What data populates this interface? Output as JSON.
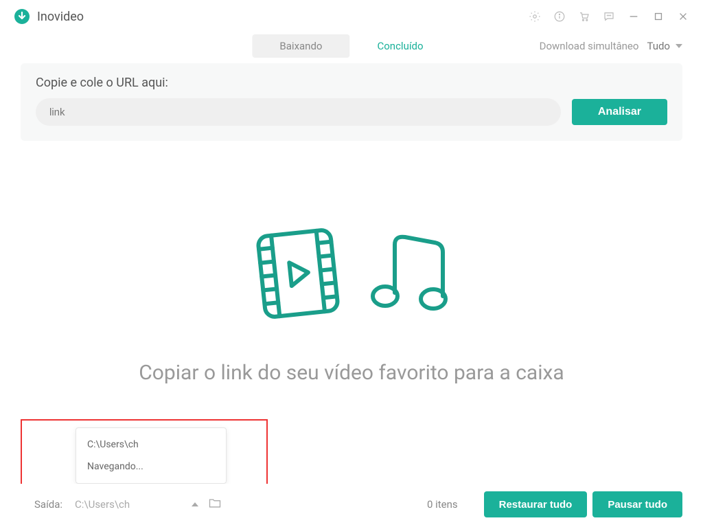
{
  "app": {
    "title": "Inovideo"
  },
  "tabs": {
    "downloading": "Baixando",
    "completed": "Concluído"
  },
  "simultaneous": {
    "label": "Download simultâneo",
    "value": "Tudo"
  },
  "url_section": {
    "label": "Copie e cole o URL aqui:",
    "placeholder": "link",
    "analyze_label": "Analisar"
  },
  "empty": {
    "message": "Copiar o link do seu vídeo favorito para a caixa"
  },
  "footer": {
    "output_label": "Saída:",
    "output_path": "C:\\Users\\ch",
    "items_count": "0 itens",
    "restore_label": "Restaurar tudo",
    "pause_label": "Pausar tudo"
  },
  "dropdown": {
    "item1": "C:\\Users\\ch",
    "item2": "Navegando..."
  }
}
